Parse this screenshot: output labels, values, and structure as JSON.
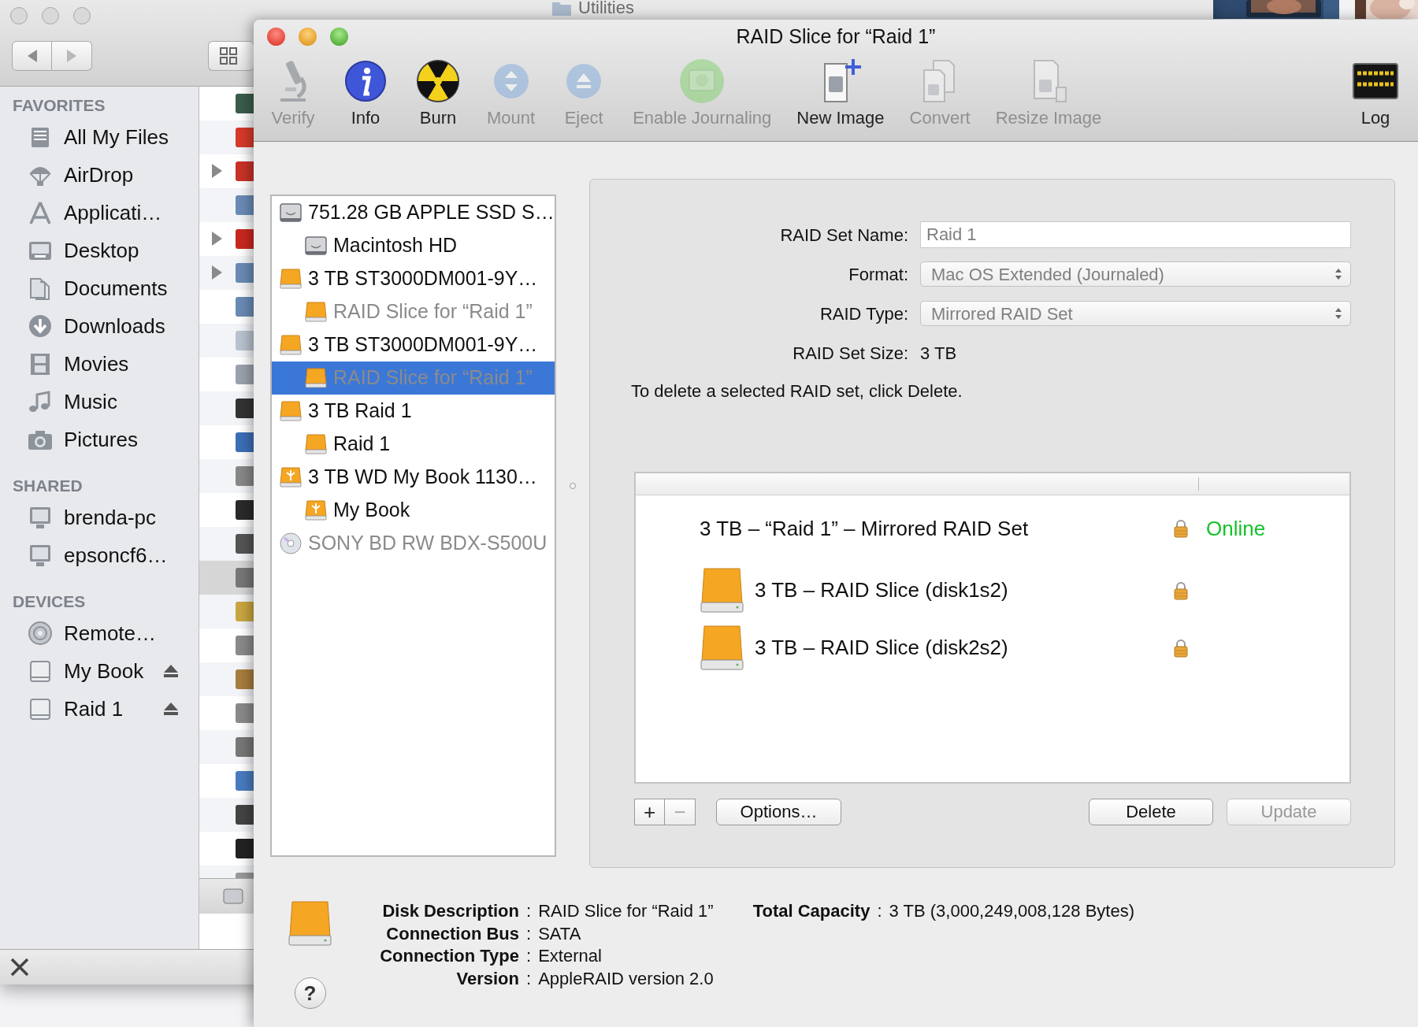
{
  "finder": {
    "title": "Utilities",
    "sidebar": [
      {
        "header": "FAVORITES",
        "items": [
          {
            "label": "All My Files"
          },
          {
            "label": "AirDrop"
          },
          {
            "label": "Applicati…"
          },
          {
            "label": "Desktop"
          },
          {
            "label": "Documents"
          },
          {
            "label": "Downloads"
          },
          {
            "label": "Movies"
          },
          {
            "label": "Music"
          },
          {
            "label": "Pictures"
          }
        ]
      },
      {
        "header": "SHARED",
        "items": [
          {
            "label": "brenda-pc"
          },
          {
            "label": "epsoncf6…"
          }
        ]
      },
      {
        "header": "DEVICES",
        "items": [
          {
            "label": "Remote…"
          },
          {
            "label": "My Book",
            "ejectable": true
          },
          {
            "label": "Raid 1",
            "ejectable": true
          }
        ]
      }
    ]
  },
  "window": {
    "title": "RAID Slice for “Raid 1”"
  },
  "toolbar": [
    {
      "label": "Verify",
      "disabled": true
    },
    {
      "label": "Info",
      "disabled": false
    },
    {
      "label": "Burn",
      "disabled": false
    },
    {
      "label": "Mount",
      "disabled": true
    },
    {
      "label": "Eject",
      "disabled": true
    },
    {
      "label": "Enable Journaling",
      "disabled": true
    },
    {
      "label": "New Image",
      "disabled": false
    },
    {
      "label": "Convert",
      "disabled": true
    },
    {
      "label": "Resize Image",
      "disabled": true
    },
    {
      "label": "Log",
      "disabled": false
    }
  ],
  "disks": [
    {
      "label": "751.28 GB APPLE SSD S…",
      "kind": "internal",
      "dimmed": false,
      "selected": false,
      "children": [
        {
          "label": "Macintosh HD",
          "kind": "internal",
          "dimmed": false,
          "selected": false
        }
      ]
    },
    {
      "label": "3 TB ST3000DM001-9Y…",
      "kind": "external",
      "dimmed": false,
      "selected": false,
      "children": [
        {
          "label": "RAID Slice for “Raid 1”",
          "kind": "external",
          "dimmed": true,
          "selected": false
        }
      ]
    },
    {
      "label": "3 TB ST3000DM001-9Y…",
      "kind": "external",
      "dimmed": false,
      "selected": false,
      "children": [
        {
          "label": "RAID Slice for “Raid 1”",
          "kind": "external",
          "dimmed": true,
          "selected": true
        }
      ]
    },
    {
      "label": "3 TB Raid 1",
      "kind": "external",
      "dimmed": false,
      "selected": false,
      "children": [
        {
          "label": "Raid 1",
          "kind": "external",
          "dimmed": false,
          "selected": false
        }
      ]
    },
    {
      "label": "3 TB WD My Book 1130…",
      "kind": "usb",
      "dimmed": false,
      "selected": false,
      "children": [
        {
          "label": "My Book",
          "kind": "usb",
          "dimmed": false,
          "selected": false
        }
      ]
    },
    {
      "label": "SONY BD RW BDX-S500U",
      "kind": "optical",
      "dimmed": true,
      "selected": false
    }
  ],
  "raid_form": {
    "fields": [
      {
        "label": "RAID Set Name:",
        "kind": "text",
        "value": "Raid 1",
        "disabled": true
      },
      {
        "label": "Format:",
        "kind": "popup",
        "value": "Mac OS Extended (Journaled)",
        "disabled": true
      },
      {
        "label": "RAID Type:",
        "kind": "popup",
        "value": "Mirrored RAID Set",
        "disabled": true
      },
      {
        "label": "RAID Set Size:",
        "kind": "static",
        "value": "3 TB",
        "disabled": false
      }
    ],
    "hint": "To delete a selected RAID set, click Delete."
  },
  "raid_table": {
    "set": {
      "label": "3 TB – “Raid 1” – Mirrored RAID Set",
      "locked": true,
      "status": "Online"
    },
    "members": [
      {
        "label": "3 TB – RAID Slice (disk1s2)",
        "locked": true
      },
      {
        "label": "3 TB – RAID Slice (disk2s2)",
        "locked": true
      }
    ]
  },
  "add_remove": [
    {
      "label": "+",
      "disabled": false
    },
    {
      "label": "−",
      "disabled": true
    }
  ],
  "buttons_left": [
    {
      "label": "Options…",
      "disabled": false
    }
  ],
  "buttons_right": [
    {
      "label": "Delete",
      "disabled": false
    },
    {
      "label": "Update",
      "disabled": true
    }
  ],
  "info": {
    "separator": ":",
    "left": [
      {
        "label": "Disk Description",
        "value": "RAID Slice for “Raid 1”"
      },
      {
        "label": "Connection Bus",
        "value": "SATA"
      },
      {
        "label": "Connection Type",
        "value": "External"
      },
      {
        "label": "Version",
        "value": "AppleRAID version 2.0"
      }
    ],
    "right": [
      {
        "label": "Total Capacity",
        "value": "3 TB (3,000,249,008,128 Bytes)"
      }
    ]
  },
  "help": "?"
}
